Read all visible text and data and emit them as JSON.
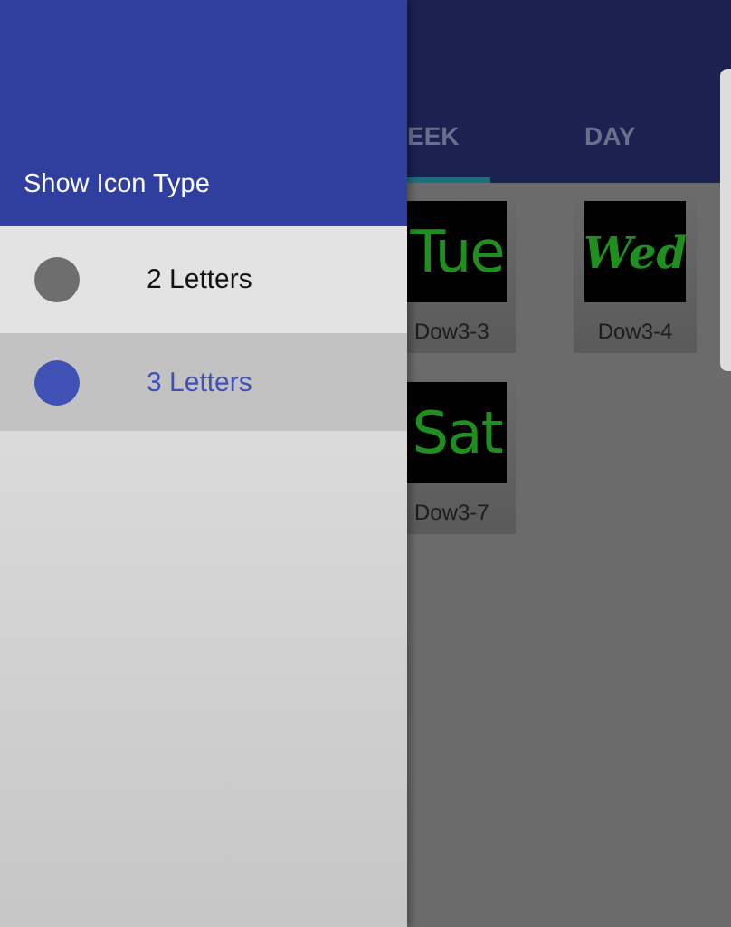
{
  "drawer": {
    "title": "Show Icon Type",
    "options": [
      {
        "label": "2 Letters",
        "selected": false
      },
      {
        "label": "3 Letters",
        "selected": true
      }
    ]
  },
  "tabs": [
    {
      "label": "EEK",
      "selected": true
    },
    {
      "label": "DAY",
      "selected": false
    }
  ],
  "tiles": [
    {
      "word": "Tue",
      "caption": "Dow3-3",
      "kind": "print"
    },
    {
      "word": "Wed",
      "caption": "Dow3-4",
      "kind": "script"
    },
    {
      "word": "Sat",
      "caption": "Dow3-7",
      "kind": "print"
    }
  ]
}
